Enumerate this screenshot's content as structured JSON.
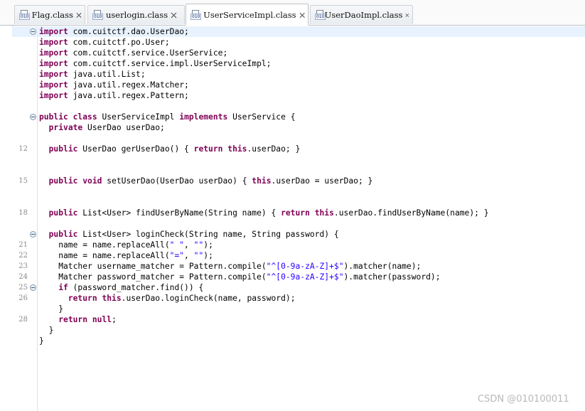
{
  "tabs": [
    {
      "label": "Flag.class",
      "active": false,
      "icon": "class-file-icon"
    },
    {
      "label": "userlogin.class",
      "active": false,
      "icon": "class-file-icon"
    },
    {
      "label": "UserServiceImpl.class",
      "active": true,
      "icon": "class-file-icon"
    },
    {
      "label": "UserDaoImpl.class",
      "active": false,
      "icon": "class-file-icon"
    }
  ],
  "class_icon_badge": "010",
  "editor": {
    "lines": [
      {
        "n": "",
        "fold": true,
        "current": true,
        "tokens": [
          [
            "kw",
            "import"
          ],
          [
            "t",
            " com.cuitctf.dao.UserDao;"
          ]
        ]
      },
      {
        "n": "",
        "tokens": [
          [
            "kw",
            "import"
          ],
          [
            "t",
            " com.cuitctf.po.User;"
          ]
        ]
      },
      {
        "n": "",
        "tokens": [
          [
            "kw",
            "import"
          ],
          [
            "t",
            " com.cuitctf.service.UserService;"
          ]
        ]
      },
      {
        "n": "",
        "tokens": [
          [
            "kw",
            "import"
          ],
          [
            "t",
            " com.cuitctf.service.impl.UserServiceImpl;"
          ]
        ]
      },
      {
        "n": "",
        "tokens": [
          [
            "kw",
            "import"
          ],
          [
            "t",
            " java.util.List;"
          ]
        ]
      },
      {
        "n": "",
        "tokens": [
          [
            "kw",
            "import"
          ],
          [
            "t",
            " java.util.regex.Matcher;"
          ]
        ]
      },
      {
        "n": "",
        "tokens": [
          [
            "kw",
            "import"
          ],
          [
            "t",
            " java.util.regex.Pattern;"
          ]
        ]
      },
      {
        "n": "",
        "tokens": []
      },
      {
        "n": "",
        "fold": true,
        "tokens": [
          [
            "kw",
            "public"
          ],
          [
            "t",
            " "
          ],
          [
            "kw",
            "class"
          ],
          [
            "t",
            " UserServiceImpl "
          ],
          [
            "kw",
            "implements"
          ],
          [
            "t",
            " UserService {"
          ]
        ]
      },
      {
        "n": "",
        "tokens": [
          [
            "t",
            "  "
          ],
          [
            "kw",
            "private"
          ],
          [
            "t",
            " UserDao userDao;"
          ]
        ]
      },
      {
        "n": "",
        "tokens": []
      },
      {
        "n": "12",
        "tokens": [
          [
            "t",
            "  "
          ],
          [
            "kw",
            "public"
          ],
          [
            "t",
            " UserDao gerUserDao() { "
          ],
          [
            "kw",
            "return"
          ],
          [
            "t",
            " "
          ],
          [
            "kw",
            "this"
          ],
          [
            "t",
            ".userDao; }"
          ]
        ]
      },
      {
        "n": "",
        "tokens": []
      },
      {
        "n": "",
        "tokens": []
      },
      {
        "n": "15",
        "tokens": [
          [
            "t",
            "  "
          ],
          [
            "kw",
            "public"
          ],
          [
            "t",
            " "
          ],
          [
            "kw",
            "void"
          ],
          [
            "t",
            " setUserDao(UserDao userDao) { "
          ],
          [
            "kw",
            "this"
          ],
          [
            "t",
            ".userDao = userDao; }"
          ]
        ]
      },
      {
        "n": "",
        "tokens": []
      },
      {
        "n": "",
        "tokens": []
      },
      {
        "n": "18",
        "tokens": [
          [
            "t",
            "  "
          ],
          [
            "kw",
            "public"
          ],
          [
            "t",
            " List<User> findUserByName(String name) { "
          ],
          [
            "kw",
            "return"
          ],
          [
            "t",
            " "
          ],
          [
            "kw",
            "this"
          ],
          [
            "t",
            ".userDao.findUserByName(name); }"
          ]
        ]
      },
      {
        "n": "",
        "tokens": []
      },
      {
        "n": "",
        "fold": true,
        "tokens": [
          [
            "t",
            "  "
          ],
          [
            "kw",
            "public"
          ],
          [
            "t",
            " List<User> loginCheck(String name, String password) {"
          ]
        ]
      },
      {
        "n": "21",
        "tokens": [
          [
            "t",
            "    name = name.replaceAll("
          ],
          [
            "str",
            "\" \""
          ],
          [
            "t",
            ", "
          ],
          [
            "str",
            "\"\""
          ],
          [
            "t",
            ");"
          ]
        ]
      },
      {
        "n": "22",
        "tokens": [
          [
            "t",
            "    name = name.replaceAll("
          ],
          [
            "str",
            "\"=\""
          ],
          [
            "t",
            ", "
          ],
          [
            "str",
            "\"\""
          ],
          [
            "t",
            ");"
          ]
        ]
      },
      {
        "n": "23",
        "tokens": [
          [
            "t",
            "    Matcher username_matcher = Pattern.compile("
          ],
          [
            "str",
            "\"^[0-9a-zA-Z]+$\""
          ],
          [
            "t",
            ").matcher(name);"
          ]
        ]
      },
      {
        "n": "24",
        "tokens": [
          [
            "t",
            "    Matcher password_matcher = Pattern.compile("
          ],
          [
            "str",
            "\"^[0-9a-zA-Z]+$\""
          ],
          [
            "t",
            ").matcher(password);"
          ]
        ]
      },
      {
        "n": "25",
        "fold": true,
        "tokens": [
          [
            "t",
            "    "
          ],
          [
            "kw",
            "if"
          ],
          [
            "t",
            " (password_matcher.find()) {"
          ]
        ]
      },
      {
        "n": "26",
        "tokens": [
          [
            "t",
            "      "
          ],
          [
            "kw",
            "return"
          ],
          [
            "t",
            " "
          ],
          [
            "kw",
            "this"
          ],
          [
            "t",
            ".userDao.loginCheck(name, password);"
          ]
        ]
      },
      {
        "n": "",
        "tokens": [
          [
            "t",
            "    }"
          ]
        ]
      },
      {
        "n": "28",
        "tokens": [
          [
            "t",
            "    "
          ],
          [
            "kw",
            "return"
          ],
          [
            "t",
            " "
          ],
          [
            "kw",
            "null"
          ],
          [
            "t",
            ";"
          ]
        ]
      },
      {
        "n": "",
        "tokens": [
          [
            "t",
            "  }"
          ]
        ]
      },
      {
        "n": "",
        "tokens": [
          [
            "t",
            "}"
          ]
        ]
      }
    ]
  },
  "watermark": "CSDN @010100011",
  "colors": {
    "keyword": "#7f0055",
    "string": "#2a00ff",
    "current_line": "#e8f2fe"
  }
}
